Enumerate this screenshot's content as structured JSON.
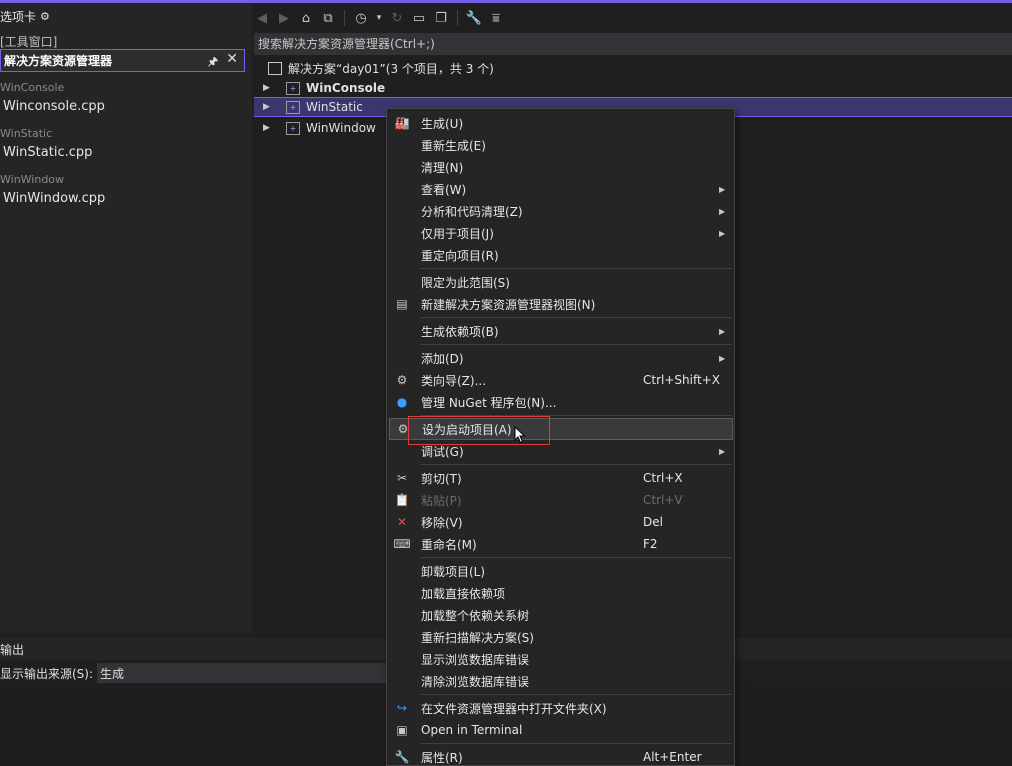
{
  "left_panel": {
    "header_title": "选项卡",
    "tool_window_label": "[工具窗口]",
    "active_tab": "解决方案资源管理器",
    "groups": [
      {
        "label": "WinConsole",
        "file": "Winconsole.cpp"
      },
      {
        "label": "WinStatic",
        "file": "WinStatic.cpp"
      },
      {
        "label": "WinWindow",
        "file": "WinWindow.cpp"
      }
    ]
  },
  "toolbar": {
    "icons": [
      "back-icon",
      "forward-icon",
      "home-icon",
      "switch-views-icon",
      "history-icon",
      "dropdown-icon",
      "refresh-icon",
      "collapse-all-icon",
      "show-all-files-icon",
      "properties-wrench-icon",
      "pending-changes-icon"
    ]
  },
  "search": {
    "placeholder": "搜索解决方案资源管理器(Ctrl+;)"
  },
  "tree": {
    "solution": "解决方案“day01”(3 个项目，共 3 个)",
    "projects": [
      {
        "name": "WinConsole",
        "bold": true
      },
      {
        "name": "WinStatic",
        "selected": true
      },
      {
        "name": "WinWindow"
      }
    ]
  },
  "output": {
    "title": "输出",
    "source_label": "显示输出来源(S):",
    "source_value": "生成"
  },
  "context_menu": {
    "items": [
      {
        "label": "生成(U)",
        "icon": "build-icon"
      },
      {
        "label": "重新生成(E)"
      },
      {
        "label": "清理(N)"
      },
      {
        "label": "查看(W)",
        "submenu": true
      },
      {
        "label": "分析和代码清理(Z)",
        "submenu": true
      },
      {
        "label": "仅用于项目(J)",
        "submenu": true
      },
      {
        "label": "重定向项目(R)"
      },
      {
        "separator": true
      },
      {
        "label": "限定为此范围(S)"
      },
      {
        "label": "新建解决方案资源管理器视图(N)",
        "icon": "new-view-icon"
      },
      {
        "separator": true
      },
      {
        "label": "生成依赖项(B)",
        "submenu": true
      },
      {
        "separator": true
      },
      {
        "label": "添加(D)",
        "submenu": true
      },
      {
        "label": "类向导(Z)...",
        "shortcut": "Ctrl+Shift+X",
        "icon": "class-wizard-icon"
      },
      {
        "label": "管理 NuGet 程序包(N)...",
        "icon": "nuget-icon"
      },
      {
        "separator": true
      },
      {
        "label": "设为启动项目(A)",
        "icon": "gear-icon",
        "highlight": true
      },
      {
        "label": "调试(G)",
        "submenu": true
      },
      {
        "separator": true
      },
      {
        "label": "剪切(T)",
        "shortcut": "Ctrl+X",
        "icon": "scissors-icon"
      },
      {
        "label": "粘贴(P)",
        "shortcut": "Ctrl+V",
        "icon": "paste-icon",
        "disabled": true
      },
      {
        "label": "移除(V)",
        "shortcut": "Del",
        "icon": "remove-x-icon"
      },
      {
        "label": "重命名(M)",
        "shortcut": "F2",
        "icon": "rename-icon"
      },
      {
        "separator": true
      },
      {
        "label": "卸载项目(L)"
      },
      {
        "label": "加载直接依赖项"
      },
      {
        "label": "加载整个依赖关系树"
      },
      {
        "label": "重新扫描解决方案(S)"
      },
      {
        "label": "显示浏览数据库错误"
      },
      {
        "label": "清除浏览数据库错误"
      },
      {
        "separator": true
      },
      {
        "label": "在文件资源管理器中打开文件夹(X)",
        "icon": "open-folder-arrow-icon"
      },
      {
        "label": "Open in Terminal",
        "icon": "terminal-icon"
      },
      {
        "separator": true
      },
      {
        "label": "属性(R)",
        "shortcut": "Alt+Enter",
        "icon": "wrench-icon"
      }
    ]
  },
  "colors": {
    "accent": "#7160e8",
    "highlight_box": "#e03c3c",
    "menu_bg": "#252526",
    "remove_icon": "#e05050",
    "refresh_icon": "#3b9cff"
  }
}
